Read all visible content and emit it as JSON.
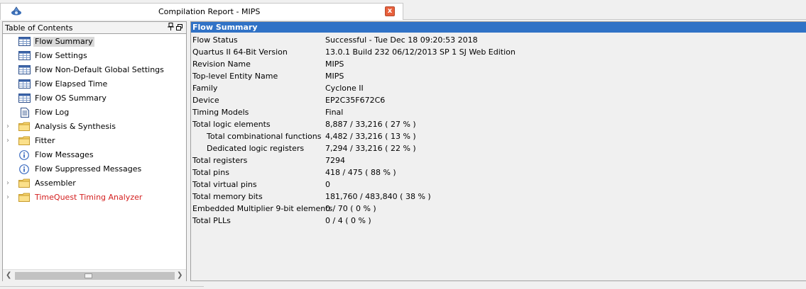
{
  "window": {
    "tab_title": "Compilation Report - MIPS",
    "close_label": "x"
  },
  "toc": {
    "title": "Table of Contents",
    "items": [
      {
        "label": "Flow Summary",
        "icon": "table-icon",
        "selected": true
      },
      {
        "label": "Flow Settings",
        "icon": "table-icon"
      },
      {
        "label": "Flow Non-Default Global Settings",
        "icon": "table-icon"
      },
      {
        "label": "Flow Elapsed Time",
        "icon": "table-icon"
      },
      {
        "label": "Flow OS Summary",
        "icon": "table-icon"
      },
      {
        "label": "Flow Log",
        "icon": "document-icon"
      },
      {
        "label": "Analysis & Synthesis",
        "icon": "folder-icon",
        "expandable": true
      },
      {
        "label": "Fitter",
        "icon": "folder-icon",
        "expandable": true
      },
      {
        "label": "Flow Messages",
        "icon": "info-icon"
      },
      {
        "label": "Flow Suppressed Messages",
        "icon": "info-icon"
      },
      {
        "label": "Assembler",
        "icon": "folder-icon",
        "expandable": true
      },
      {
        "label": "TimeQuest Timing Analyzer",
        "icon": "folder-icon",
        "expandable": true,
        "color": "#d42020"
      }
    ]
  },
  "summary": {
    "title": "Flow Summary",
    "rows": [
      {
        "label": "Flow Status",
        "value": "Successful - Tue Dec 18 09:20:53 2018"
      },
      {
        "label": "Quartus II 64-Bit Version",
        "value": "13.0.1 Build 232 06/12/2013 SP 1 SJ Web Edition"
      },
      {
        "label": "Revision Name",
        "value": "MIPS"
      },
      {
        "label": "Top-level Entity Name",
        "value": "MIPS"
      },
      {
        "label": "Family",
        "value": "Cyclone II"
      },
      {
        "label": "Device",
        "value": "EP2C35F672C6"
      },
      {
        "label": "Timing Models",
        "value": "Final"
      },
      {
        "label": "Total logic elements",
        "value": "8,887 / 33,216 ( 27 % )"
      },
      {
        "label": "Total combinational functions",
        "value": "4,482 / 33,216 ( 13 % )",
        "indent": true
      },
      {
        "label": "Dedicated logic registers",
        "value": "7,294 / 33,216 ( 22 % )",
        "indent": true
      },
      {
        "label": "Total registers",
        "value": "7294"
      },
      {
        "label": "Total pins",
        "value": "418 / 475 ( 88 % )"
      },
      {
        "label": "Total virtual pins",
        "value": "0"
      },
      {
        "label": "Total memory bits",
        "value": "181,760 / 483,840 ( 38 % )"
      },
      {
        "label": "Embedded Multiplier 9-bit elements",
        "value": "0 / 70 ( 0 % )"
      },
      {
        "label": "Total PLLs",
        "value": "0 / 4 ( 0 % )"
      }
    ]
  },
  "colors": {
    "header_blue": "#3072c6",
    "selected_bg": "#d9d9d9",
    "error_red": "#d42020"
  }
}
